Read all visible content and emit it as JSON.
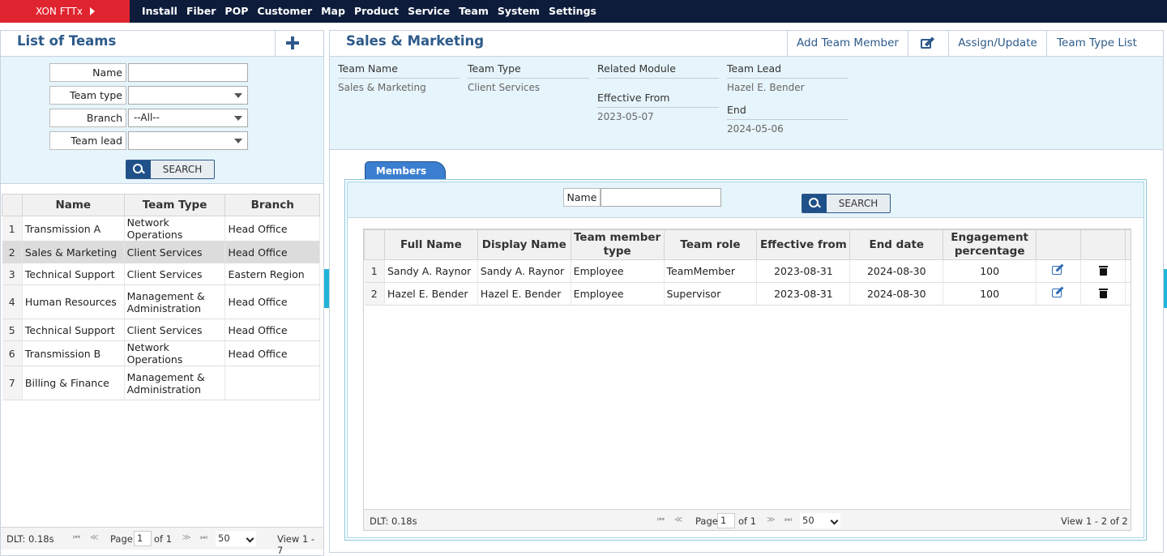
{
  "app": {
    "brand": "XON FTTx"
  },
  "menu": [
    "Install",
    "Fiber",
    "POP",
    "Customer",
    "Map",
    "Product",
    "Service",
    "Team",
    "System",
    "Settings"
  ],
  "left": {
    "title": "List of Teams",
    "filters": {
      "name_label": "Name",
      "name_value": "",
      "team_type_label": "Team type",
      "team_type_value": "",
      "branch_label": "Branch",
      "branch_value": "--All--",
      "team_lead_label": "Team lead",
      "team_lead_value": "",
      "search_label": "SEARCH"
    },
    "columns": [
      "Name",
      "Team Type",
      "Branch"
    ],
    "rows": [
      {
        "n": "1",
        "name": "Transmission A",
        "type": "Network Operations",
        "branch": "Head Office"
      },
      {
        "n": "2",
        "name": "Sales & Marketing",
        "type": "Client Services",
        "branch": "Head Office"
      },
      {
        "n": "3",
        "name": "Technical Support",
        "type": "Client Services",
        "branch": "Eastern Region"
      },
      {
        "n": "4",
        "name": "Human Resources",
        "type": "Management & Administration",
        "branch": "Head Office"
      },
      {
        "n": "5",
        "name": "Technical Support",
        "type": "Client Services",
        "branch": "Head Office"
      },
      {
        "n": "6",
        "name": "Transmission B",
        "type": "Network Operations",
        "branch": "Head Office"
      },
      {
        "n": "7",
        "name": "Billing & Finance",
        "type": "Management & Administration",
        "branch": ""
      }
    ],
    "selected_row": 2,
    "pager": {
      "dlt": "DLT: 0.18s",
      "page_label": "Page",
      "page": "1",
      "of": "of 1",
      "size": "50",
      "view": "View 1 - 7"
    }
  },
  "right": {
    "title": "Sales & Marketing",
    "toolbar": {
      "add_member": "Add Team Member",
      "assign": "Assign/Update",
      "type_list": "Team Type List"
    },
    "info": {
      "team_name_label": "Team Name",
      "team_name": "Sales & Marketing",
      "team_type_label": "Team Type",
      "team_type": "Client Services",
      "related_label": "Related Module",
      "effective_label": "Effective From",
      "effective": "2023-05-07",
      "lead_label": "Team Lead",
      "lead": "Hazel E. Bender",
      "end_label": "End",
      "end": "2024-05-06"
    },
    "tab": "Members",
    "member_search": {
      "name_label": "Name",
      "name_value": "",
      "search_label": "SEARCH"
    },
    "member_columns": [
      "Full Name",
      "Display Name",
      "Team member type",
      "Team role",
      "Effective from",
      "End date",
      "Engagement percentage"
    ],
    "members": [
      {
        "n": "1",
        "full": "Sandy A. Raynor",
        "display": "Sandy A. Raynor",
        "type": "Employee",
        "role": "TeamMember",
        "from": "2023-08-31",
        "end": "2024-08-30",
        "pct": "100"
      },
      {
        "n": "2",
        "full": "Hazel E. Bender",
        "display": "Hazel E. Bender",
        "type": "Employee",
        "role": "Supervisor",
        "from": "2023-08-31",
        "end": "2024-08-30",
        "pct": "100"
      }
    ],
    "pager": {
      "dlt": "DLT: 0.18s",
      "page_label": "Page",
      "page": "1",
      "of": "of 1",
      "size": "50",
      "view": "View 1 - 2 of 2"
    }
  }
}
